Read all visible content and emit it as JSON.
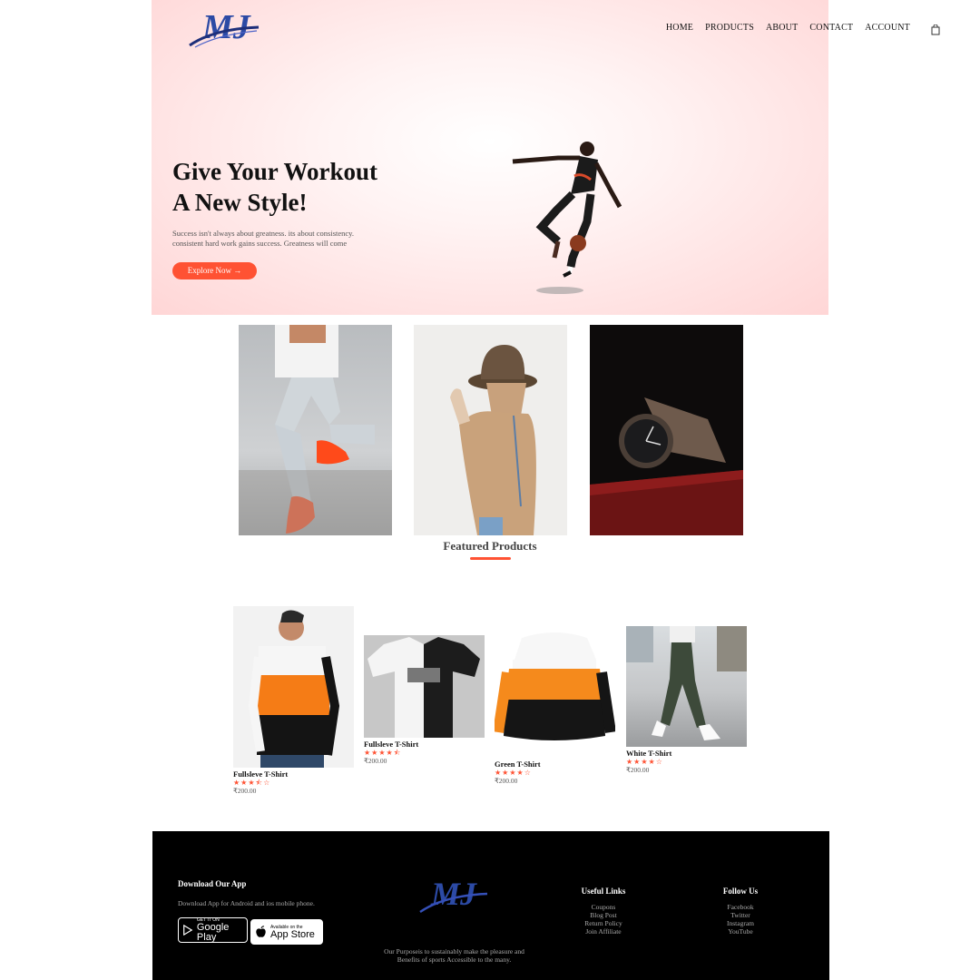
{
  "brand": {
    "logo_text": "MJ"
  },
  "nav": {
    "items": [
      "HOME",
      "PRODUCTS",
      "ABOUT",
      "CONTACT",
      "ACCOUNT"
    ],
    "cart_icon": "shopping-bag-icon"
  },
  "hero": {
    "title_line1": "Give Your Workout",
    "title_line2": "A New Style!",
    "subtitle_line1": "Success isn't always about greatness. its about consistency.",
    "subtitle_line2": "consistent hard work gains success. Greatness will come",
    "cta": "Explore Now →"
  },
  "featured": {
    "title": "Featured Products",
    "products": [
      {
        "name": "Fullsleve T-Shirt",
        "rating": 3.5,
        "stars": "★★★⯪☆",
        "price": "₹200.00"
      },
      {
        "name": "Fullsleve T-Shirt",
        "rating": 4.5,
        "stars": "★★★★⯪",
        "price": "₹200.00"
      },
      {
        "name": "Green T-Shirt",
        "rating": 4,
        "stars": "★★★★☆",
        "price": "₹200.00"
      },
      {
        "name": "White T-Shirt",
        "rating": 4,
        "stars": "★★★★☆",
        "price": "₹200.00"
      }
    ]
  },
  "footer": {
    "download_title": "Download Our App",
    "download_text": "Download App for Android and ios mobile phone.",
    "google_small": "GET IT ON",
    "google_big": "Google Play",
    "apple_small": "Available on the",
    "apple_big": "App Store",
    "purpose_line1": "Our Purposeis to sustainably make the pleasure and",
    "purpose_line2": "Benefits of sports Accessible to the many.",
    "useful_title": "Useful Links",
    "useful_links": [
      "Coupons",
      "Blog Post",
      "Return Policy",
      "Join Affiliate"
    ],
    "follow_title": "Follow Us",
    "follow_links": [
      "Facebook",
      "Twitter",
      "Instagram",
      "YouTube"
    ]
  },
  "colors": {
    "accent": "#ff5233",
    "hero_bg": "#ffd6d6",
    "footer_bg": "#000000"
  }
}
